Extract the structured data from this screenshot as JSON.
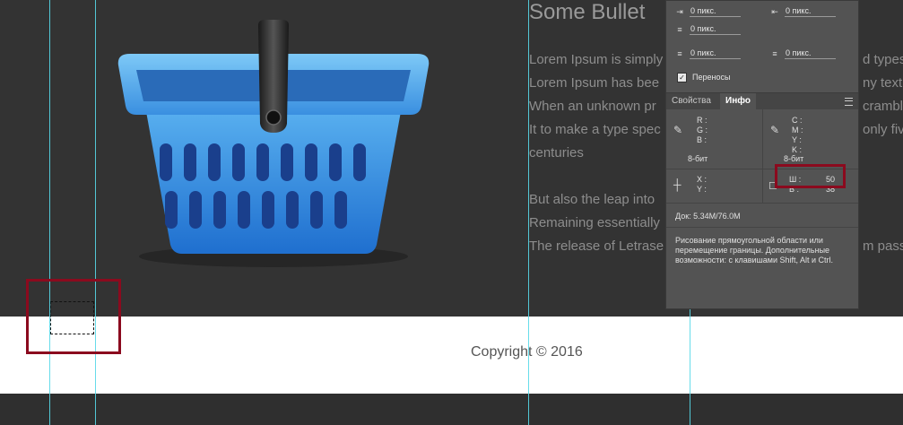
{
  "canvas": {
    "heading": "Some Bullet",
    "paragraph_lines": [
      "Lorem Ipsum is simply",
      "Lorem Ipsum has bee",
      "When an unknown pr",
      "It to make a type spec",
      "centuries",
      "",
      "But also the leap into",
      "Remaining essentially",
      "The release of Letrase"
    ],
    "right_fragments": [
      "d types",
      "ny text",
      "crambl",
      "only fiv",
      "m pass"
    ],
    "footer_text": "Copyright © 2016",
    "guide_color": "#57d8e8",
    "highlight_color": "#8b0a1e"
  },
  "panel": {
    "indent_row1_left_value": "0 пикс.",
    "indent_row1_right_value": "0 пикс.",
    "indent_row2_value": "0 пикс.",
    "space_row_left_value": "0 пикс.",
    "space_row_right_value": "0 пикс.",
    "hyphenation_label": "Переносы",
    "hyphenation_checked": "✓",
    "tabs": [
      "Свойства",
      "Инфо"
    ],
    "rgb_labels": [
      "R :",
      "G :",
      "B :"
    ],
    "cmyk_labels": [
      "C :",
      "M :",
      "Y :",
      "K :"
    ],
    "bit_left": "8-бит",
    "bit_right": "8-бит",
    "xy_labels": [
      "X :",
      "Y :"
    ],
    "w_label": "Ш :",
    "w_value": "50",
    "h_label": "В :",
    "h_value": "38",
    "doc_info": "Док: 5.34M/76.0M",
    "hint": "Рисование прямоугольной области или перемещение границы. Дополнительные возможности: с клавишами Shift, Alt и Ctrl."
  }
}
